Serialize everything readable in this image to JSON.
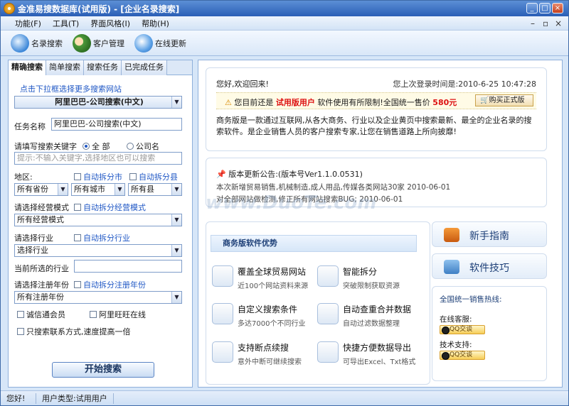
{
  "window": {
    "title": "金准易搜数据库(试用版) - [企业名录搜索]"
  },
  "menu": [
    "功能(F)",
    "工具(T)",
    "界面风格(I)",
    "帮助(H)"
  ],
  "toolbar": {
    "items": [
      {
        "label": "名录搜索",
        "icon": "search-globe-icon"
      },
      {
        "label": "客户管理",
        "icon": "users-icon"
      },
      {
        "label": "在线更新",
        "icon": "update-globe-icon"
      }
    ]
  },
  "left": {
    "tabs": [
      "精确搜索",
      "简单搜索",
      "搜索任务",
      "已完成任务"
    ],
    "hint_link": "点击下拉框选择更多搜索网站",
    "site_select": "阿里巴巴-公司搜索(中文)",
    "task_name_label": "任务名称",
    "task_name_value": "阿里巴巴-公司搜索(中文)",
    "keyword_label": "请填写搜索关键字",
    "radio_all": "全 部",
    "radio_company": "公司名",
    "keyword_placeholder": "提示:不输入关键字,选择地区也可以搜索",
    "region_label": "地区:",
    "split_city": "自动拆分市",
    "split_county": "自动拆分县",
    "province": "所有省份",
    "city": "所有城市",
    "county": "所有县",
    "mode_label": "请选择经营模式",
    "split_mode": "自动拆分经营模式",
    "mode_value": "所有经营模式",
    "industry_label": "请选择行业",
    "split_industry": "自动拆分行业",
    "industry_value": "选择行业",
    "current_industry_label": "当前所选的行业",
    "year_label": "请选择注册年份",
    "split_year": "自动拆分注册年份",
    "year_value": "所有注册年份",
    "cb_trust": "诚信通会员",
    "cb_wangwang": "阿里旺旺在线",
    "cb_contact": "只搜索联系方式,速度提高一倍",
    "start_button": "开始搜索"
  },
  "right": {
    "greeting": "您好,欢迎回来!",
    "last_login": "您上次登录时间是:2010-6-25 10:47:28",
    "trial_notice_a": "您目前还是",
    "trial_user": "试用版用户",
    "trial_notice_b": "软件使用有所限制!全国统一售价",
    "price": "580元",
    "buy_button": "购买正式版",
    "intro": "商务版是一款通过互联网,从各大商务、行业以及企业黄页中搜索最新、最全的企业名录的搜索软件。是企业销售人员的客户搜索专家,让您在销售道路上所向披靡!",
    "update_title": "版本更新公告:(版本号Ver1.1.0.0531)",
    "update_line1": "本次新增贸易销售,机械制造,成人用品,传媒各类网站30家 2010-06-01",
    "update_line2": "对全部网站做检测,修正所有网站搜索BUG; 2010-06-01",
    "features_title": "商务版软件优势",
    "features": [
      {
        "title": "覆盖全球贸易网站",
        "sub": "近100个网站资料来源",
        "icon": "globe-chart-icon"
      },
      {
        "title": "智能拆分",
        "sub": "突破限制获取资源",
        "icon": "person-icon"
      },
      {
        "title": "自定义搜索条件",
        "sub": "多达7000个不同行业",
        "icon": "pie-chart-icon"
      },
      {
        "title": "自动查重合并数据",
        "sub": "自动过滤数据整理",
        "icon": "merge-icon"
      },
      {
        "title": "支持断点续搜",
        "sub": "意外中断可继续搜索",
        "icon": "magnifier-icon"
      },
      {
        "title": "快捷方便数据导出",
        "sub": "可导出Excel、Txt格式",
        "icon": "export-icon"
      }
    ],
    "guide_button": "新手指南",
    "tips_button": "软件技巧",
    "hotline_title": "全国统一销售热线:",
    "online_service": "在线客服:",
    "tech_support": "技术支持:",
    "qq_label": "QQ交谈",
    "watermark": "www.DuoTe.com"
  },
  "status": {
    "greeting": "您好!",
    "user_type": "用户类型:试用用户"
  }
}
